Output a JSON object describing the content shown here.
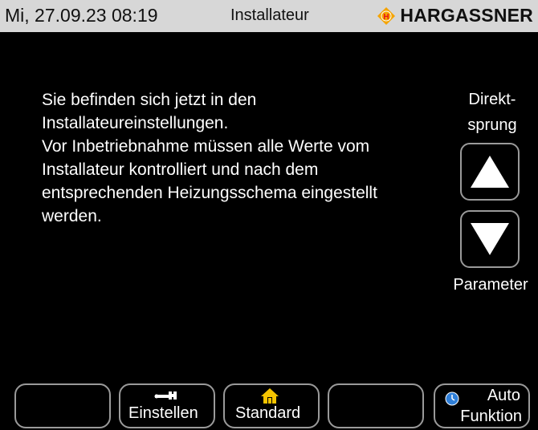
{
  "header": {
    "datetime": "Mi, 27.09.23 08:19",
    "mode": "Installateur",
    "brand": "HARGASSNER",
    "logo_letter": "H",
    "logo_color": "#f5a400",
    "logo_letter_color": "#e8141b"
  },
  "message": {
    "lines": [
      "Sie befinden sich jetzt in den",
      "Installateureinstellungen.",
      "Vor Inbetriebnahme müssen alle Werte vom",
      "Installateur kontrolliert und nach dem",
      "entsprechenden Heizungsschema eingestellt",
      "werden."
    ]
  },
  "side": {
    "direkt_line1": "Direkt-",
    "direkt_line2": "sprung",
    "up_icon": "arrow-up-icon",
    "down_icon": "arrow-down-icon",
    "parameter_label": "Parameter"
  },
  "softkeys": {
    "key1_label": "",
    "einstellen_label": "Einstellen",
    "einstellen_icon": "wrench-icon",
    "standard_label": "Standard",
    "standard_icon": "home-icon",
    "key4_label": "",
    "auto_label": "Auto",
    "funktion_label": "Funktion",
    "auto_icon": "clock-icon",
    "auto_icon_color": "#2f7fd8"
  }
}
